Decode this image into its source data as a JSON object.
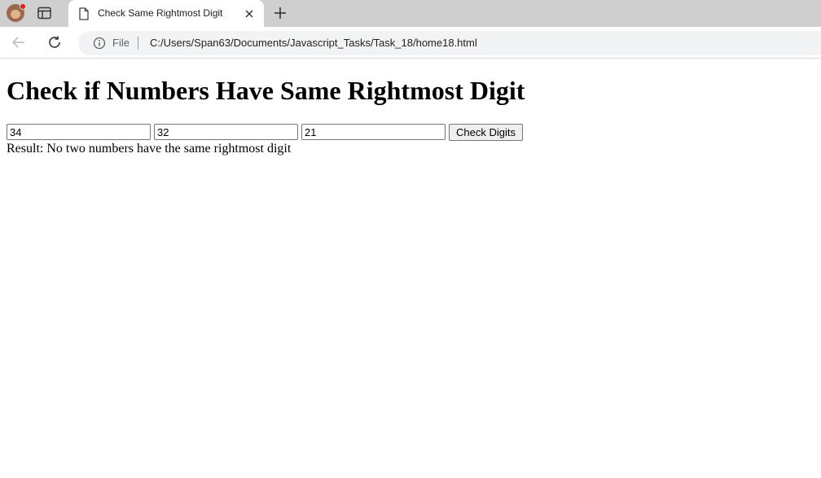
{
  "browser": {
    "tab": {
      "title": "Check Same Rightmost Digit"
    },
    "address_bar": {
      "scheme_label": "File",
      "url": "C:/Users/Span63/Documents/Javascript_Tasks/Task_18/home18.html"
    },
    "icons": {
      "profile": "profile-avatar-icon",
      "tab_actions": "tab-actions-icon",
      "page": "page-icon",
      "close": "close-icon",
      "new_tab": "plus-icon",
      "back": "back-arrow-icon",
      "reload": "reload-icon",
      "info": "info-icon"
    },
    "colors": {
      "tabstrip": "#cfcfcf",
      "notification_dot": "#e2231a"
    }
  },
  "page": {
    "heading": "Check if Numbers Have Same Rightmost Digit",
    "inputs": [
      {
        "value": "34"
      },
      {
        "value": "32"
      },
      {
        "value": "21"
      }
    ],
    "button_label": "Check Digits",
    "result_text": "Result: No two numbers have the same rightmost digit"
  }
}
